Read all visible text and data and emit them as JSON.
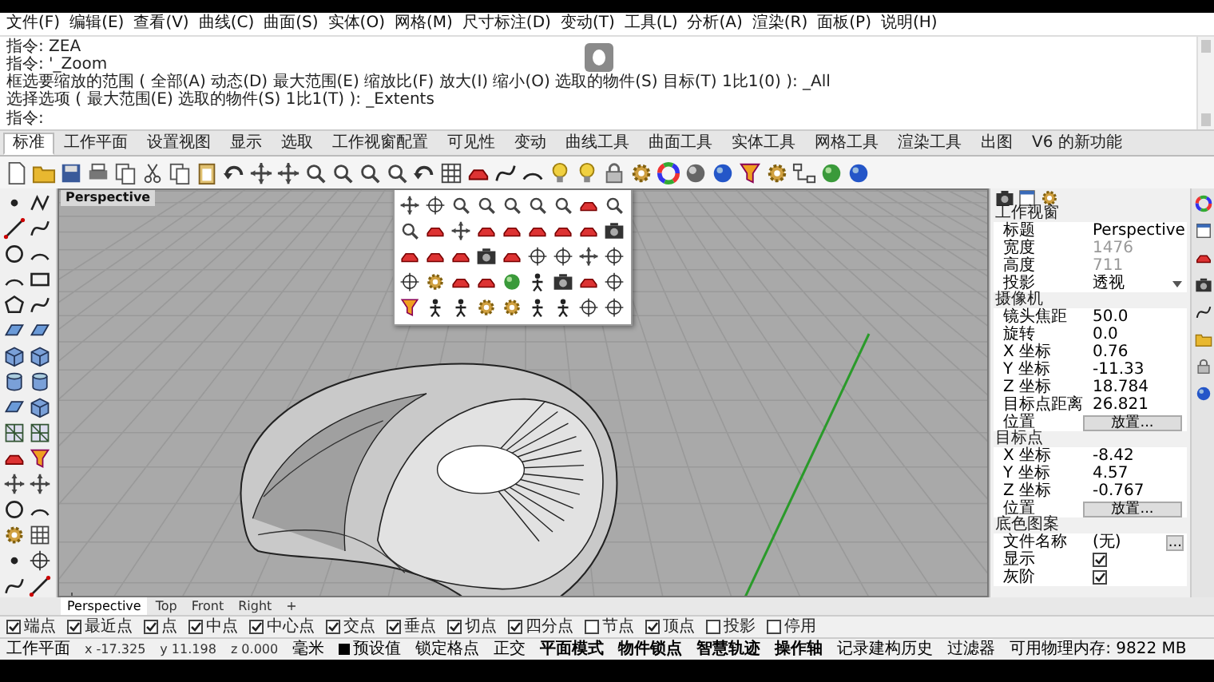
{
  "menu": [
    "文件(F)",
    "编辑(E)",
    "查看(V)",
    "曲线(C)",
    "曲面(S)",
    "实体(O)",
    "网格(M)",
    "尺寸标注(D)",
    "变动(T)",
    "工具(L)",
    "分析(A)",
    "渲染(R)",
    "面板(P)",
    "说明(H)"
  ],
  "command_history": [
    "指令: ZEA",
    "指令: '_Zoom",
    "框选要缩放的范围 ( 全部(A) 动态(D) 最大范围(E) 缩放比(F) 放大(I) 缩小(O) 选取的物件(S) 目标(T) 1比1(0) ): _All",
    "选择选项 ( 最大范围(E) 选取的物件(S) 1比1(T) ): _Extents"
  ],
  "command_prompt": "指令:",
  "toolbar_tabs": [
    {
      "label": "标准",
      "selected": true
    },
    {
      "label": "工作平面",
      "selected": false
    },
    {
      "label": "设置视图",
      "selected": false
    },
    {
      "label": "显示",
      "selected": false
    },
    {
      "label": "选取",
      "selected": false
    },
    {
      "label": "工作视窗配置",
      "selected": false
    },
    {
      "label": "可见性",
      "selected": false
    },
    {
      "label": "变动",
      "selected": false
    },
    {
      "label": "曲线工具",
      "selected": false
    },
    {
      "label": "曲面工具",
      "selected": false
    },
    {
      "label": "实体工具",
      "selected": false
    },
    {
      "label": "网格工具",
      "selected": false
    },
    {
      "label": "渲染工具",
      "selected": false
    },
    {
      "label": "出图",
      "selected": false
    },
    {
      "label": "V6 的新功能",
      "selected": false
    }
  ],
  "viewport": {
    "title": "Perspective"
  },
  "viewport_tabs": [
    {
      "label": "Perspective",
      "selected": true
    },
    {
      "label": "Top",
      "selected": false
    },
    {
      "label": "Front",
      "selected": false
    },
    {
      "label": "Right",
      "selected": false
    }
  ],
  "add_tab": "+",
  "properties": {
    "sections": [
      {
        "title": "工作视窗",
        "rows": [
          {
            "label": "标题",
            "value": "Perspective",
            "kind": "text"
          },
          {
            "label": "宽度",
            "value": "1476",
            "kind": "disabled"
          },
          {
            "label": "高度",
            "value": "711",
            "kind": "disabled"
          },
          {
            "label": "投影",
            "value": "透视",
            "kind": "dropdown"
          }
        ]
      },
      {
        "title": "摄像机",
        "rows": [
          {
            "label": "镜头焦距",
            "value": "50.0",
            "kind": "text"
          },
          {
            "label": "旋转",
            "value": "0.0",
            "kind": "text"
          },
          {
            "label": "X 坐标",
            "value": "0.76",
            "kind": "text"
          },
          {
            "label": "Y 坐标",
            "value": "-11.33",
            "kind": "text"
          },
          {
            "label": "Z 坐标",
            "value": "18.784",
            "kind": "text"
          },
          {
            "label": "目标点距离",
            "value": "26.821",
            "kind": "text"
          },
          {
            "label": "位置",
            "value": "放置...",
            "kind": "button"
          }
        ]
      },
      {
        "title": "目标点",
        "rows": [
          {
            "label": "X 坐标",
            "value": "-8.42",
            "kind": "text"
          },
          {
            "label": "Y 坐标",
            "value": "4.57",
            "kind": "text"
          },
          {
            "label": "Z 坐标",
            "value": "-0.767",
            "kind": "text"
          },
          {
            "label": "位置",
            "value": "放置...",
            "kind": "button"
          }
        ]
      },
      {
        "title": "底色图案",
        "rows": [
          {
            "label": "文件名称",
            "value": "(无)",
            "kind": "file",
            "button": "..."
          },
          {
            "label": "显示",
            "checked": true,
            "kind": "checkbox"
          },
          {
            "label": "灰阶",
            "checked": true,
            "kind": "checkbox"
          }
        ]
      }
    ]
  },
  "osnaps": [
    {
      "label": "端点",
      "checked": true
    },
    {
      "label": "最近点",
      "checked": true
    },
    {
      "label": "点",
      "checked": true
    },
    {
      "label": "中点",
      "checked": true
    },
    {
      "label": "中心点",
      "checked": true
    },
    {
      "label": "交点",
      "checked": true
    },
    {
      "label": "垂点",
      "checked": true
    },
    {
      "label": "切点",
      "checked": true
    },
    {
      "label": "四分点",
      "checked": true
    },
    {
      "label": "节点",
      "checked": false
    },
    {
      "label": "顶点",
      "checked": true
    },
    {
      "label": "投影",
      "checked": false
    },
    {
      "label": "停用",
      "checked": false
    }
  ],
  "status_bar": [
    {
      "text": "工作平面",
      "kind": "label"
    },
    {
      "text": "x -17.325",
      "kind": "coord"
    },
    {
      "text": "y 11.198",
      "kind": "coord"
    },
    {
      "text": "z 0.000",
      "kind": "coord"
    },
    {
      "text": "毫米",
      "kind": "label"
    },
    {
      "text": "预设值",
      "kind": "layer",
      "color": "#000000"
    },
    {
      "text": "锁定格点",
      "kind": "toggle",
      "on": false
    },
    {
      "text": "正交",
      "kind": "toggle",
      "on": false
    },
    {
      "text": "平面模式",
      "kind": "toggle",
      "on": true
    },
    {
      "text": "物件锁点",
      "kind": "toggle",
      "on": true
    },
    {
      "text": "智慧轨迹",
      "kind": "toggle",
      "on": true
    },
    {
      "text": "操作轴",
      "kind": "toggle",
      "on": true
    },
    {
      "text": "记录建构历史",
      "kind": "toggle",
      "on": false
    },
    {
      "text": "过滤器",
      "kind": "toggle",
      "on": false
    },
    {
      "text": "可用物理内存: 9822 MB",
      "kind": "label"
    }
  ]
}
